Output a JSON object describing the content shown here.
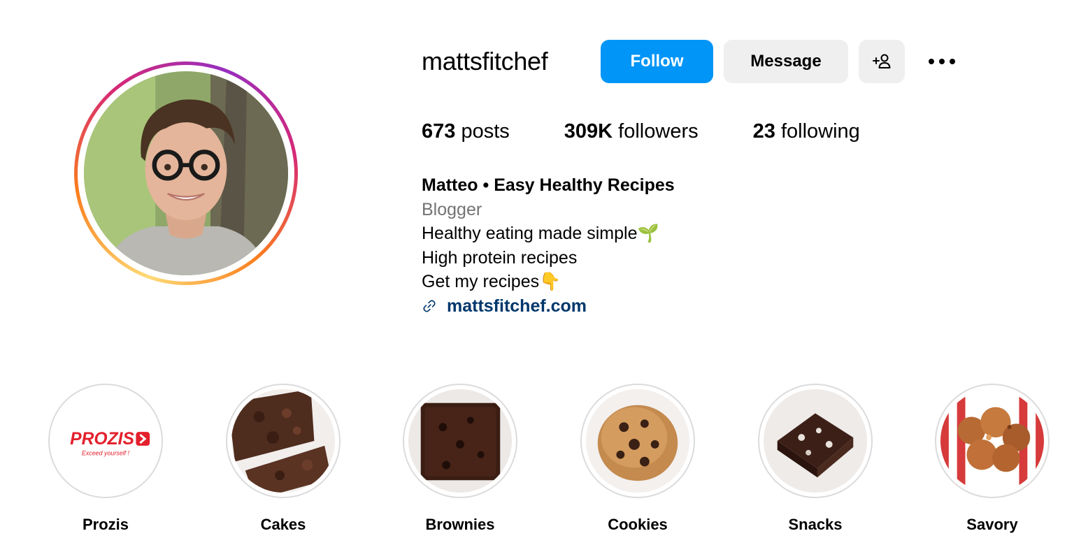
{
  "profile": {
    "username": "mattsfitchef",
    "follow_label": "Follow",
    "message_label": "Message",
    "add_user_icon": "add-user-icon",
    "more_icon": "more-options-icon"
  },
  "stats": {
    "posts_count": "673",
    "posts_label": "posts",
    "followers_count": "309K",
    "followers_label": "followers",
    "following_count": "23",
    "following_label": "following"
  },
  "bio": {
    "full_name": "Matteo • Easy Healthy Recipes",
    "category": "Blogger",
    "line1": "Healthy eating made simple🌱",
    "line2": "High protein recipes",
    "line3": "Get my recipes👇",
    "link_text": "mattsfitchef.com",
    "link_icon": "link-icon"
  },
  "highlights": [
    {
      "label": "Prozis",
      "logo_text": "PROZIS",
      "logo_tagline": "Exceed yourself !"
    },
    {
      "label": "Cakes"
    },
    {
      "label": "Brownies"
    },
    {
      "label": "Cookies"
    },
    {
      "label": "Snacks"
    },
    {
      "label": "Savory"
    }
  ],
  "colors": {
    "follow_button": "#0095f6",
    "secondary_button": "#efefef",
    "link": "#00376b",
    "category_text": "#737373",
    "prozis_red": "#e3202d"
  }
}
